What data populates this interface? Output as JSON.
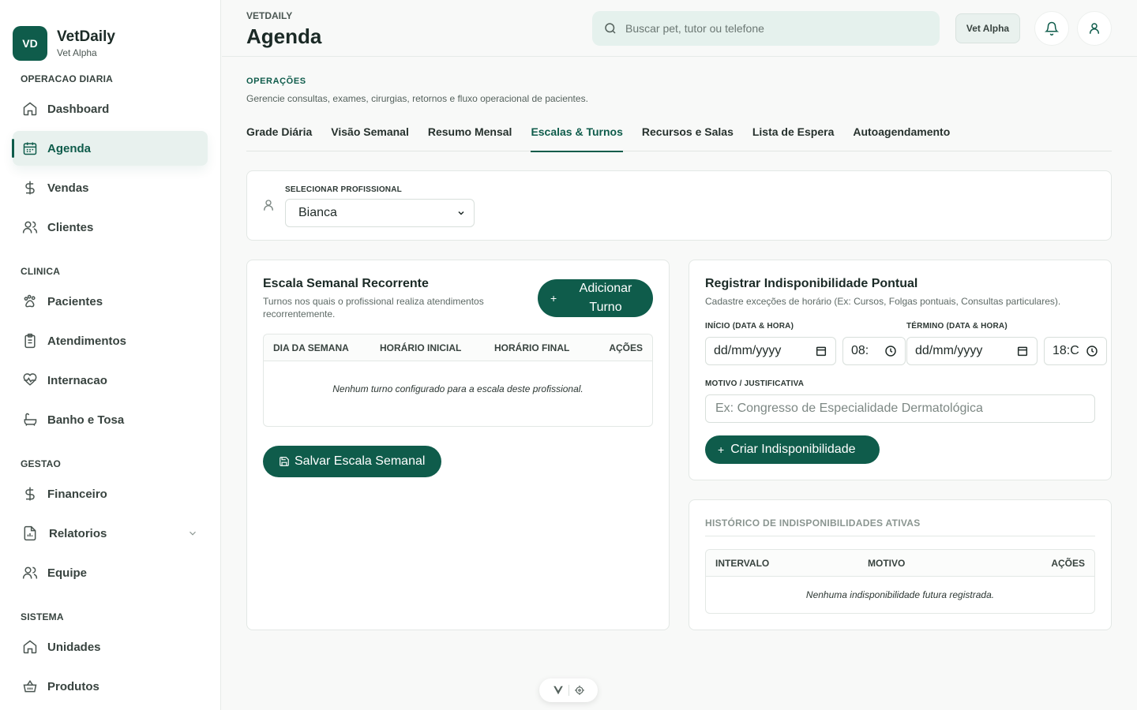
{
  "brand": {
    "logo": "VD",
    "name": "VetDaily",
    "subtitle": "Vet Alpha"
  },
  "sidebar": {
    "sections": [
      {
        "title": "OPERACAO DIARIA",
        "items": [
          {
            "label": "Dashboard",
            "icon": "home-icon"
          },
          {
            "label": "Agenda",
            "icon": "calendar-icon",
            "active": true
          },
          {
            "label": "Vendas",
            "icon": "dollar-icon"
          },
          {
            "label": "Clientes",
            "icon": "users-icon"
          }
        ]
      },
      {
        "title": "CLINICA",
        "items": [
          {
            "label": "Pacientes",
            "icon": "paw-icon"
          },
          {
            "label": "Atendimentos",
            "icon": "clipboard-icon"
          },
          {
            "label": "Internacao",
            "icon": "heart-pulse-icon"
          },
          {
            "label": "Banho e Tosa",
            "icon": "bath-icon"
          }
        ]
      },
      {
        "title": "GESTAO",
        "items": [
          {
            "label": "Financeiro",
            "icon": "dollar-icon"
          },
          {
            "label": "Relatorios",
            "icon": "report-icon",
            "expandable": true
          },
          {
            "label": "Equipe",
            "icon": "users-icon"
          }
        ]
      },
      {
        "title": "SISTEMA",
        "items": [
          {
            "label": "Unidades",
            "icon": "home-icon"
          },
          {
            "label": "Produtos",
            "icon": "basket-icon"
          }
        ]
      }
    ]
  },
  "header": {
    "breadcrumb": "VETDAILY",
    "title": "Agenda",
    "search_placeholder": "Buscar pet, tutor ou telefone",
    "unit_button": "Vet Alpha"
  },
  "section": {
    "eyebrow": "OPERAÇÕES",
    "description": "Gerencie consultas, exames, cirurgias, retornos e fluxo operacional de pacientes."
  },
  "tabs": [
    {
      "label": "Grade Diária"
    },
    {
      "label": "Visão Semanal"
    },
    {
      "label": "Resumo Mensal"
    },
    {
      "label": "Escalas & Turnos",
      "active": true
    },
    {
      "label": "Recursos e Salas"
    },
    {
      "label": "Lista de Espera"
    },
    {
      "label": "Autoagendamento"
    }
  ],
  "profissional": {
    "label": "SELECIONAR PROFISSIONAL",
    "selected": "Bianca"
  },
  "escala": {
    "title": "Escala Semanal Recorrente",
    "subtitle": "Turnos nos quais o profissional realiza atendimentos recorrentemente.",
    "add_button": "Adicionar Turno",
    "columns": [
      "DIA DA SEMANA",
      "HORÁRIO INICIAL",
      "HORÁRIO FINAL",
      "AÇÕES"
    ],
    "empty": "Nenhum turno configurado para a escala deste profissional.",
    "save_button": "Salvar Escala Semanal"
  },
  "indisponibilidade": {
    "title": "Registrar Indisponibilidade Pontual",
    "subtitle": "Cadastre exceções de horário (Ex: Cursos, Folgas pontuais, Consultas particulares).",
    "inicio_label": "INÍCIO (DATA & HORA)",
    "termino_label": "TÉRMINO (DATA & HORA)",
    "inicio_date": "dd/mm/yyyy",
    "inicio_time": "08:",
    "termino_date": "dd/mm/yyyy",
    "termino_time": "18:C",
    "motivo_label": "MOTIVO / JUSTIFICATIVA",
    "motivo_placeholder": "Ex: Congresso de Especialidade Dermatológica",
    "create_button": "Criar Indisponibilidade"
  },
  "historico": {
    "title": "HISTÓRICO DE INDISPONIBILIDADES ATIVAS",
    "columns": [
      "INTERVALO",
      "MOTIVO",
      "AÇÕES"
    ],
    "empty": "Nenhuma indisponibilidade futura registrada."
  },
  "colors": {
    "primary": "#0f5c4b",
    "active_bg": "#e8f1ee",
    "search_bg": "#e5f1ed"
  }
}
